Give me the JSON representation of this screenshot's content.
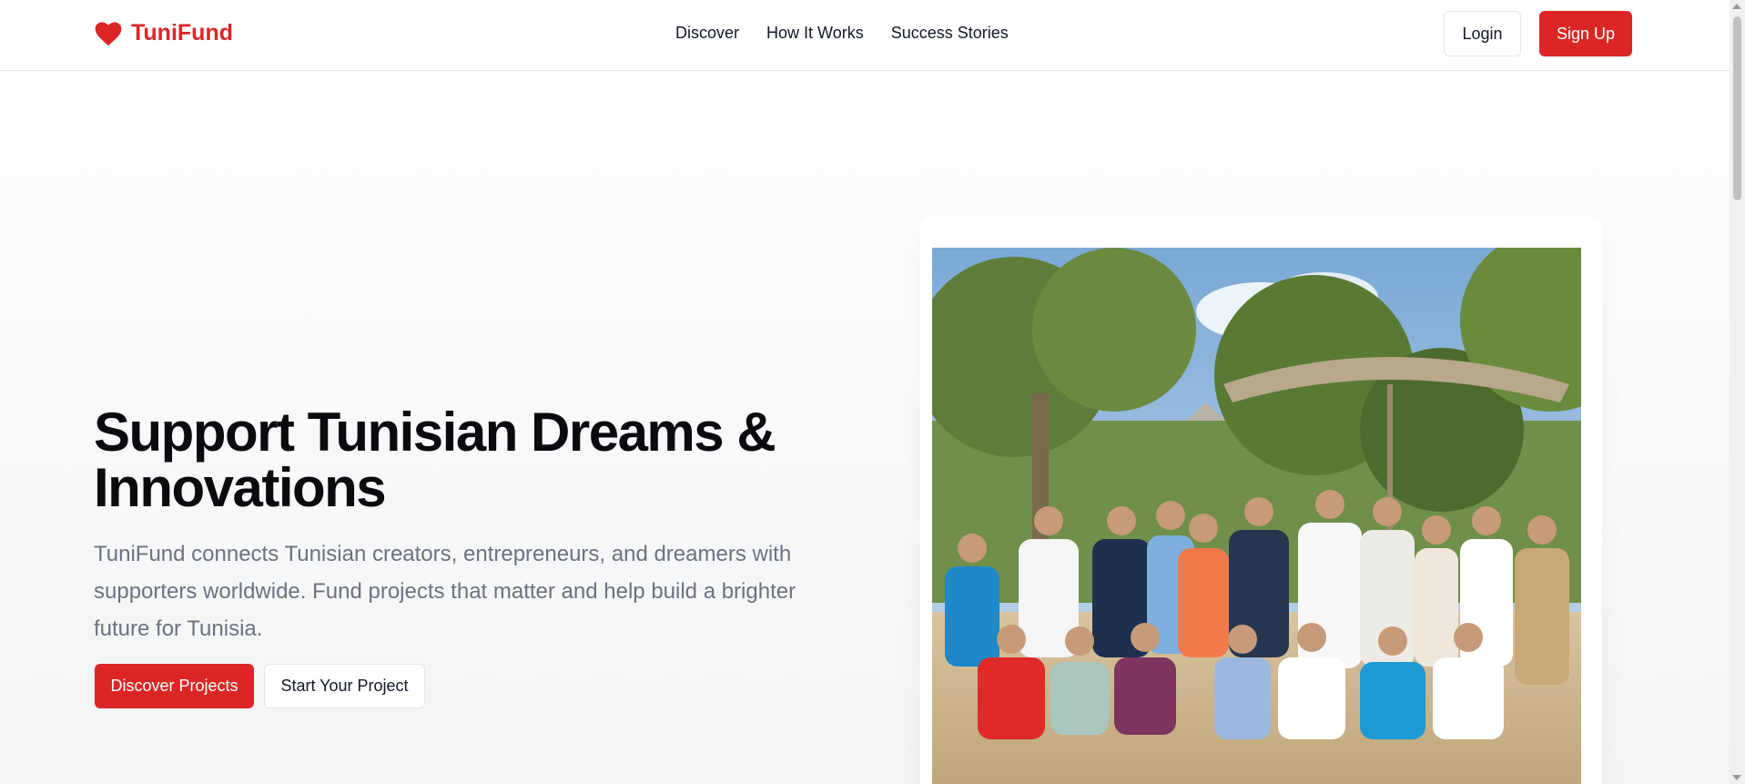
{
  "header": {
    "brand": "TuniFund",
    "brand_icon": "heart-icon",
    "brand_color": "#dc2626",
    "nav": [
      {
        "label": "Discover"
      },
      {
        "label": "How It Works"
      },
      {
        "label": "Success Stories"
      }
    ],
    "login_label": "Login",
    "signup_label": "Sign Up"
  },
  "hero": {
    "title": "Support Tunisian Dreams & Innovations",
    "description": "TuniFund connects Tunisian creators, entrepreneurs, and dreamers with supporters worldwide. Fund projects that matter and help build a brighter future for Tunisia.",
    "primary_cta": "Discover Projects",
    "secondary_cta": "Start Your Project",
    "image_subject": "group-photo"
  },
  "colors": {
    "accent": "#dc2626",
    "muted_text": "#6b7280"
  }
}
